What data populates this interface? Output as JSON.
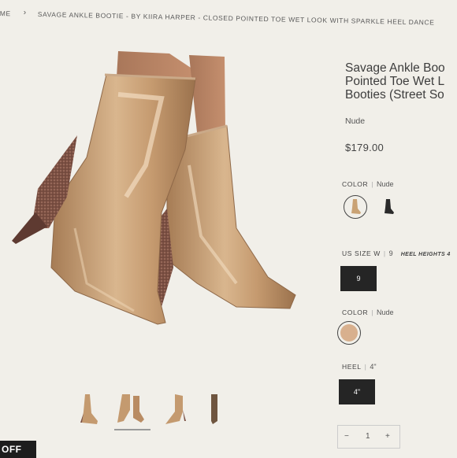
{
  "breadcrumb": {
    "home": "ME",
    "separator": "›",
    "current": "SAVAGE ANKLE BOOTIE - BY KIIRA HARPER - CLOSED POINTED TOE WET LOOK WITH SPARKLE HEEL DANCE"
  },
  "product": {
    "title": "Savage Ankle Boo\nPointed Toe Wet L\nBooties (Street So",
    "variant": "Nude",
    "price": "$179.00"
  },
  "options": {
    "color1": {
      "label": "COLOR",
      "value": "Nude",
      "swatches": [
        "nude-boot",
        "black-boot"
      ]
    },
    "us_size": {
      "label": "US SIZE W",
      "value": "9",
      "note": "HEEL HEIGHTS 4",
      "selected_button": "9"
    },
    "color2": {
      "label": "COLOR",
      "value": "Nude",
      "swatch_color": "#d8b08e"
    },
    "heel": {
      "label": "HEEL",
      "value": "4\"",
      "selected_button": "4\""
    }
  },
  "quantity": {
    "minus": "−",
    "value": "1",
    "plus": "+"
  },
  "badge": {
    "text": "OFF"
  },
  "thumbnails": [
    "side-view-pair",
    "front-view-pair",
    "angled-view",
    "back-view-single"
  ],
  "colors": {
    "accent_dark": "#252525",
    "patent_nude": "#c9a274",
    "glitter": "#8a5e4f"
  }
}
